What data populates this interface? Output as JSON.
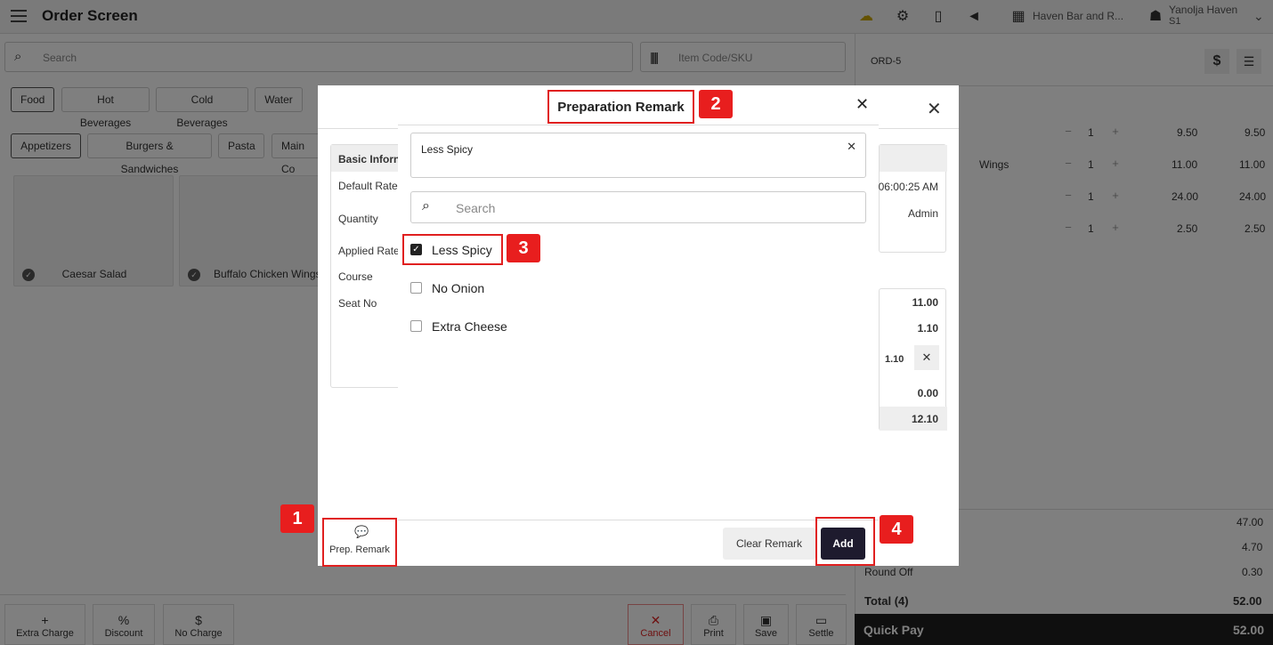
{
  "header": {
    "title": "Order Screen",
    "outlet": "Haven Bar and R...",
    "user_name": "Yanolja Haven",
    "user_sub": "S1"
  },
  "search": {
    "placeholder": "Search",
    "sku_placeholder": "Item Code/SKU"
  },
  "categories": [
    "Food",
    "Hot Beverages",
    "Cold Beverages",
    "Water"
  ],
  "subcategories": [
    "Appetizers",
    "Burgers & Sandwiches",
    "Pasta",
    "Main Co"
  ],
  "items": [
    "Caesar Salad",
    "Buffalo Chicken Wings"
  ],
  "bottom_actions": {
    "extra_charge": "Extra Charge",
    "discount": "Discount",
    "no_charge": "No Charge",
    "cancel": "Cancel",
    "print": "Print",
    "save": "Save",
    "settle": "Settle"
  },
  "order": {
    "id": "ORD-5",
    "currency_icon": "$",
    "lines": [
      {
        "name": "",
        "qty": "1",
        "price": "9.50",
        "total": "9.50"
      },
      {
        "name": "Wings",
        "qty": "1",
        "price": "11.00",
        "total": "11.00"
      },
      {
        "name": "",
        "qty": "1",
        "price": "24.00",
        "total": "24.00"
      },
      {
        "name": "",
        "qty": "1",
        "price": "2.50",
        "total": "2.50"
      }
    ],
    "summary": [
      "47.00",
      "4.70",
      "0.30"
    ],
    "round_off_label": "Round Off",
    "total_label": "Total (4)",
    "total": "52.00",
    "quick_pay": "Quick Pay",
    "quick_pay_amount": "52.00"
  },
  "item_modal": {
    "section": "Basic Inforn",
    "fields": [
      "Default Rate",
      "Quantity",
      "Applied Rate",
      "Course",
      "Seat No"
    ],
    "time": "06:00:25 AM",
    "user": "Admin",
    "values": [
      "11.00",
      "1.10",
      "1.10",
      "0.00",
      "12.10"
    ],
    "prep_remark_btn": "Prep. Remark"
  },
  "remark_modal": {
    "title": "Preparation Remark",
    "current_remark": "Less Spicy",
    "search_placeholder": "Search",
    "options": [
      {
        "label": "Less Spicy",
        "checked": true
      },
      {
        "label": "No Onion",
        "checked": false
      },
      {
        "label": "Extra Cheese",
        "checked": false
      }
    ],
    "clear_label": "Clear Remark",
    "add_label": "Add"
  },
  "annotations": [
    "1",
    "2",
    "3",
    "4"
  ],
  "colors": {
    "accent": "#e81e1e",
    "add_button": "#1e1b2e"
  }
}
